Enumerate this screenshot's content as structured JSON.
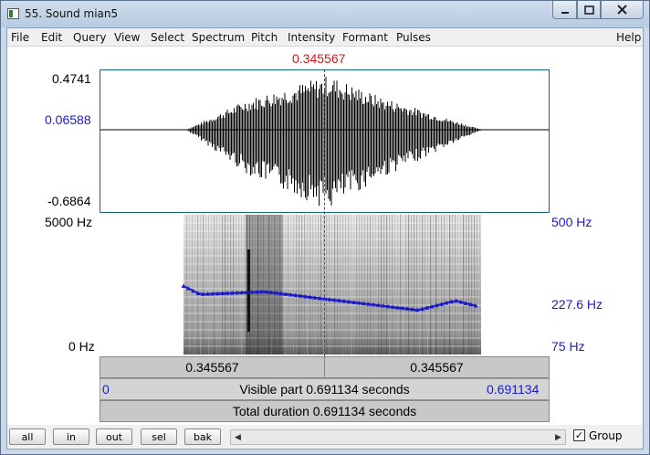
{
  "window": {
    "title": "55. Sound mian5"
  },
  "menu": {
    "items": [
      "File",
      "Edit",
      "Query",
      "View",
      "Select",
      "Spectrum",
      "Pitch",
      "Intensity",
      "Formant",
      "Pulses"
    ],
    "help": "Help"
  },
  "cursor": {
    "time": "0.345567"
  },
  "waveform": {
    "max": "0.4741",
    "mid": "0.06588",
    "min": "-0.6864"
  },
  "spectrogram": {
    "top_left": "5000 Hz",
    "bottom_left": "0 Hz",
    "top_right": "500 Hz",
    "mid_right": "227.6 Hz",
    "bottom_right": "75 Hz"
  },
  "timebar": {
    "left_seg": "0.345567",
    "right_seg": "0.345567",
    "visible_start": "0",
    "visible_label": "Visible part 0.691134 seconds",
    "visible_end": "0.691134",
    "total_label": "Total duration 0.691134 seconds"
  },
  "buttons": {
    "all": "all",
    "in": "in",
    "out": "out",
    "sel": "sel",
    "bak": "bak"
  },
  "group": {
    "label": "Group",
    "checked": true
  }
}
